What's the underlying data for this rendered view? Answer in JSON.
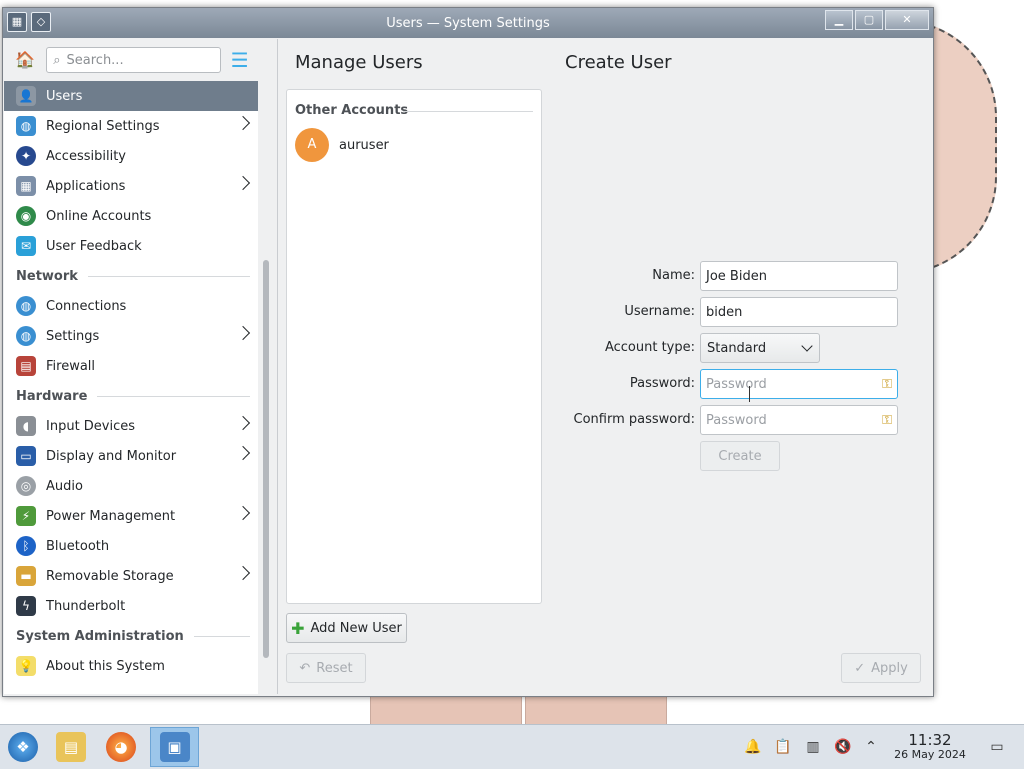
{
  "window": {
    "title": "Users — System Settings",
    "controls": {
      "minimize": "▁",
      "maximize": "▢",
      "close": "✕"
    }
  },
  "sidebar": {
    "search_placeholder": "Search...",
    "items": [
      {
        "label": "Users",
        "icon": "user-icon",
        "active": true
      },
      {
        "label": "Regional Settings",
        "icon": "globe-icon",
        "chevron": true
      },
      {
        "label": "Accessibility",
        "icon": "accessibility-icon"
      },
      {
        "label": "Applications",
        "icon": "applications-icon",
        "chevron": true
      },
      {
        "label": "Online Accounts",
        "icon": "online-accounts-icon"
      },
      {
        "label": "User Feedback",
        "icon": "feedback-icon"
      }
    ],
    "sections": [
      {
        "title": "Network",
        "items": [
          {
            "label": "Connections",
            "icon": "connections-icon"
          },
          {
            "label": "Settings",
            "icon": "network-settings-icon",
            "chevron": true
          },
          {
            "label": "Firewall",
            "icon": "firewall-icon"
          }
        ]
      },
      {
        "title": "Hardware",
        "items": [
          {
            "label": "Input Devices",
            "icon": "mouse-icon",
            "chevron": true
          },
          {
            "label": "Display and Monitor",
            "icon": "monitor-icon",
            "chevron": true
          },
          {
            "label": "Audio",
            "icon": "audio-icon"
          },
          {
            "label": "Power Management",
            "icon": "power-icon",
            "chevron": true
          },
          {
            "label": "Bluetooth",
            "icon": "bluetooth-icon"
          },
          {
            "label": "Removable Storage",
            "icon": "storage-icon",
            "chevron": true
          },
          {
            "label": "Thunderbolt",
            "icon": "thunderbolt-icon"
          }
        ]
      },
      {
        "title": "System Administration",
        "items": [
          {
            "label": "About this System",
            "icon": "info-bulb-icon"
          }
        ]
      }
    ]
  },
  "manage": {
    "title": "Manage Users",
    "accounts_header": "Other Accounts",
    "accounts": [
      {
        "initial": "A",
        "name": "auruser"
      }
    ],
    "add_button": "Add New User",
    "reset_button": "Reset"
  },
  "create": {
    "title": "Create User",
    "name_label": "Name:",
    "name_value": "Joe Biden",
    "username_label": "Username:",
    "username_value": "biden",
    "account_type_label": "Account type:",
    "account_type_value": "Standard",
    "password_label": "Password:",
    "password_placeholder": "Password",
    "confirm_label": "Confirm password:",
    "confirm_placeholder": "Password",
    "create_button": "Create",
    "apply_button": "Apply"
  },
  "taskbar": {
    "time": "11:32",
    "date": "26 May 2024"
  },
  "colors": {
    "accent": "#3daee9",
    "sidebar_active": "#6f7d8c",
    "avatar": "#f0963d"
  }
}
